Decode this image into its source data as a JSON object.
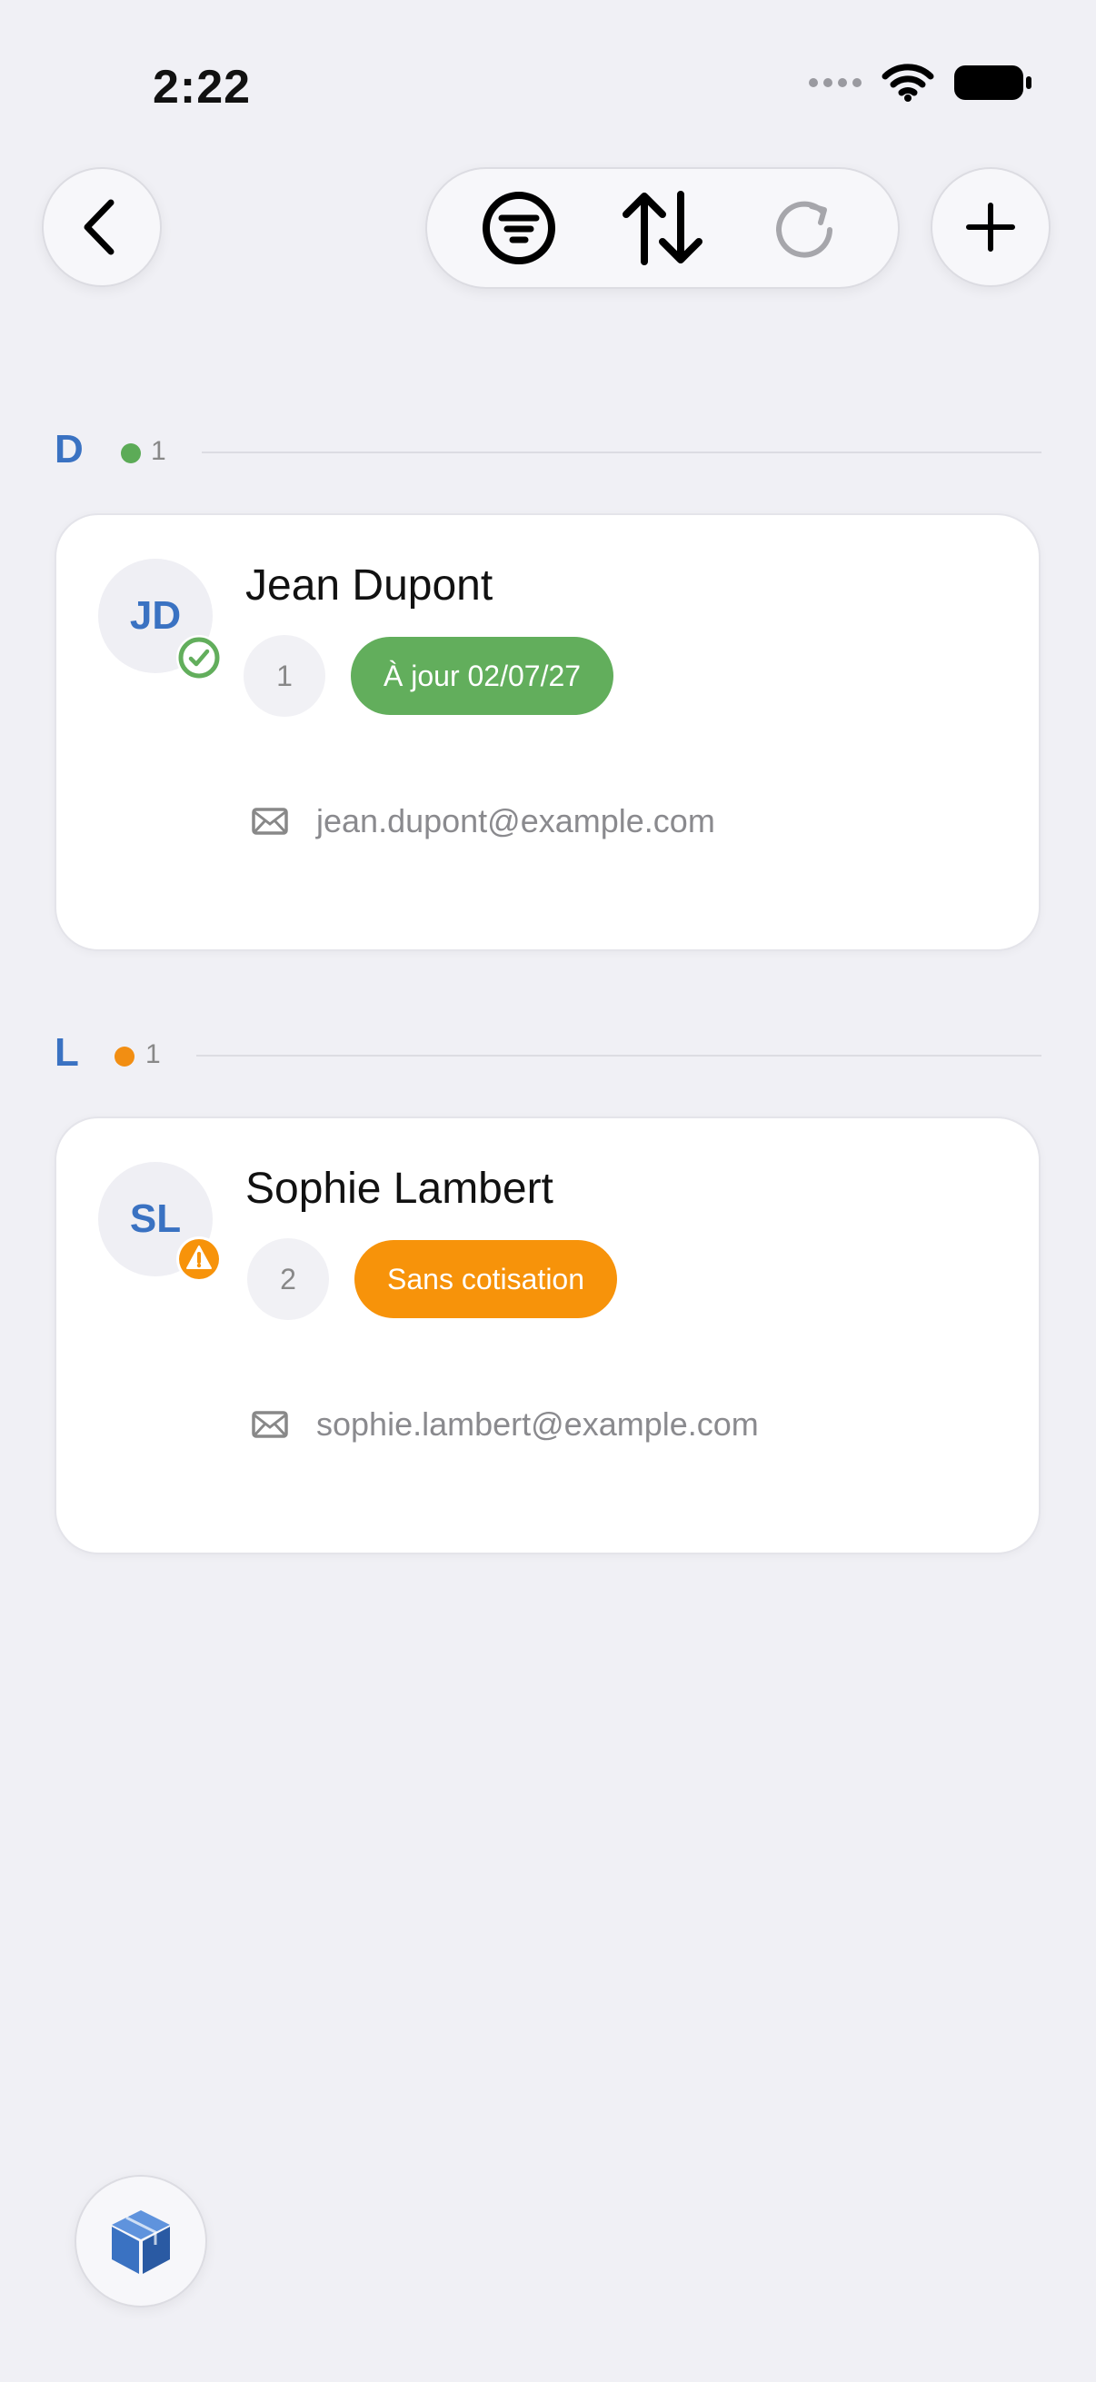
{
  "status_bar": {
    "time": "2:22"
  },
  "toolbar": {
    "icons": [
      "back-icon",
      "filter-icon",
      "sort-icon",
      "refresh-icon",
      "add-icon"
    ]
  },
  "sections": [
    {
      "letter": "D",
      "count": "1",
      "dot_color": "#5cab57",
      "contacts": [
        {
          "initials": "JD",
          "name": "Jean Dupont",
          "number": "1",
          "badge": "À jour 02/07/27",
          "badge_color": "#62ae5c",
          "status_icon": "check-icon",
          "email": "jean.dupont@example.com"
        }
      ]
    },
    {
      "letter": "L",
      "count": "1",
      "dot_color": "#f28e12",
      "contacts": [
        {
          "initials": "SL",
          "name": "Sophie Lambert",
          "number": "2",
          "badge": "Sans cotisation",
          "badge_color": "#f7930a",
          "status_icon": "warning-icon",
          "email": "sophie.lambert@example.com"
        }
      ]
    }
  ],
  "colors": {
    "accent": "#3a72c2",
    "background": "#f0f0f5"
  },
  "fab": {
    "icon": "box-icon"
  }
}
